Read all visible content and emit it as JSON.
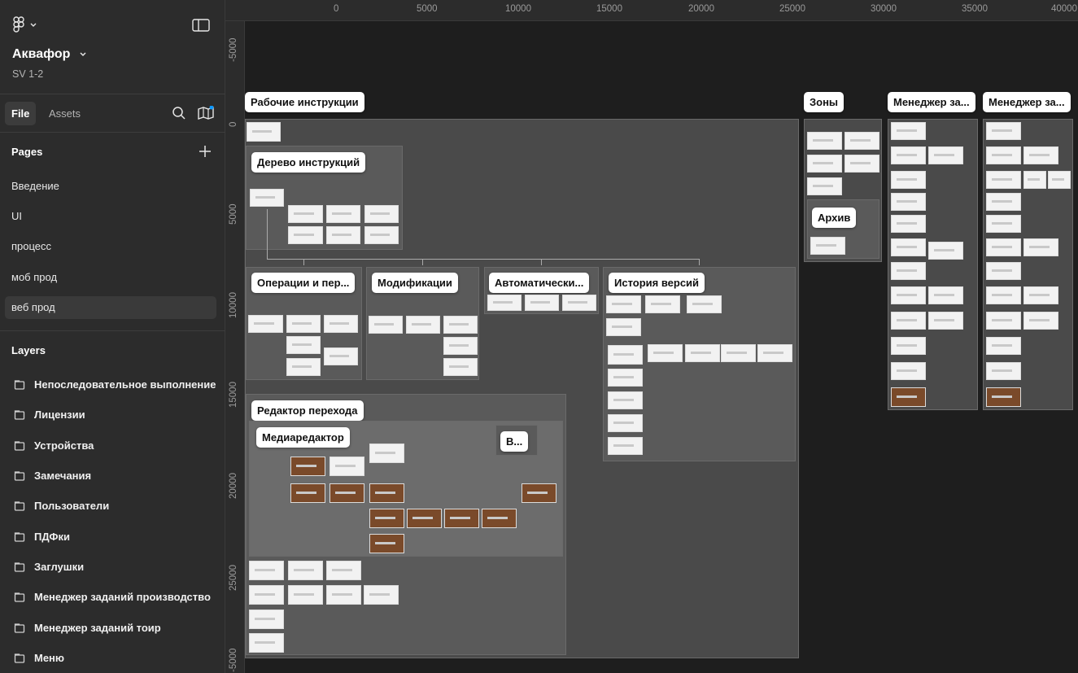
{
  "project": {
    "name": "Аквафор",
    "subtitle": "SV 1-2"
  },
  "tabs": {
    "file": "File",
    "assets": "Assets"
  },
  "pages": {
    "title": "Pages",
    "items": [
      "Введение",
      "UI",
      "процесс",
      "моб прод",
      "веб прод"
    ],
    "active_index": 4
  },
  "layers": {
    "title": "Layers",
    "items": [
      "Непоследовательное выполнение",
      "Лицензии",
      "Устройства",
      "Замечания",
      "Пользователи",
      "ПДФки",
      "Заглушки",
      "Менеджер заданий производство",
      "Менеджер заданий тоир",
      "Меню"
    ]
  },
  "ruler": {
    "top": [
      "0",
      "5000",
      "10000",
      "15000",
      "20000",
      "25000",
      "30000",
      "35000",
      "40000"
    ],
    "left": [
      "-5000",
      "0",
      "5000",
      "10000",
      "15000",
      "20000",
      "25000",
      "-5000"
    ]
  },
  "canvas": {
    "frames": {
      "work_instructions": "Рабочие инструкции",
      "tree": "Дерево инструкций",
      "operations": "Операции и пер...",
      "modifications": "Модификации",
      "automatic": "Автоматически...",
      "history": "История версий",
      "transition_editor": "Редактор перехода",
      "media_editor": "Медиаредактор",
      "v_small": "В...",
      "zones": "Зоны",
      "archive": "Архив",
      "task_manager_1": "Менеджер за...",
      "task_manager_2": "Менеджер за..."
    }
  },
  "colors": {
    "sidebar_bg": "#2c2c2c",
    "canvas_bg": "#1e1e1e",
    "accent": "#0d99ff"
  }
}
